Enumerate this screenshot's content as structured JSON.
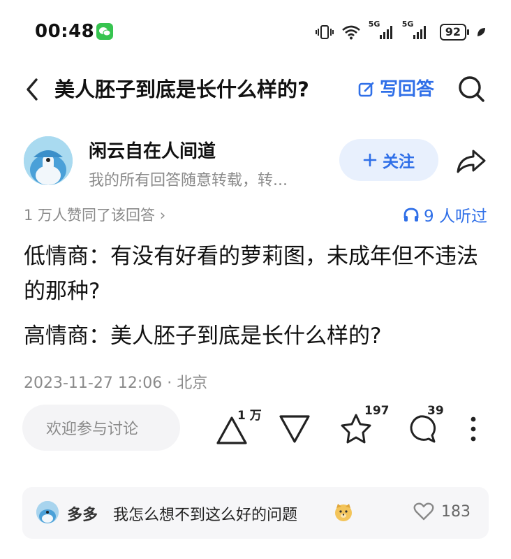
{
  "status_bar": {
    "time": "00:48",
    "signal_1_label": "5G",
    "signal_2_label": "5G",
    "battery": "92"
  },
  "header": {
    "title": "美人胚子到底是长什么样的?",
    "write_answer": "写回答"
  },
  "author": {
    "name": "闲云自在人间道",
    "bio": "我的所有回答随意转载，转...",
    "follow_label": "关注"
  },
  "meta": {
    "agree_text": "1 万人赞同了该回答 ›",
    "listen_text": "9 人听过"
  },
  "content": {
    "paragraph_1": "低情商：有没有好看的萝莉图，未成年但不违法的那种?",
    "paragraph_2": "高情商：美人胚子到底是长什么样的?"
  },
  "post_meta": "2023-11-27 12:06 · 北京",
  "actions": {
    "comment_placeholder": "欢迎参与讨论",
    "upvote_count": "1 万",
    "favorite_count": "197",
    "comment_count": "39"
  },
  "top_comment": {
    "user": "多多",
    "text": "我怎么想不到这么好的问题",
    "like_count": "183"
  },
  "colors": {
    "accent": "#2f6fe8",
    "follow_bg": "#e8f0fd",
    "muted_text": "#8a8a8a"
  }
}
